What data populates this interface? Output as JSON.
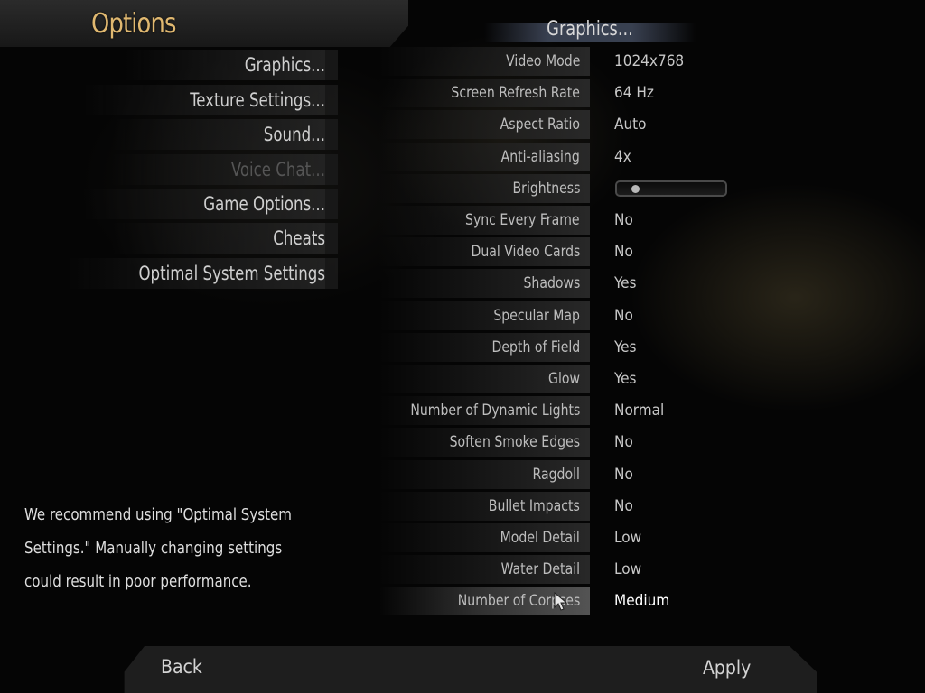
{
  "title": "Options",
  "menu": [
    {
      "label": "Graphics...",
      "disabled": false
    },
    {
      "label": "Texture Settings...",
      "disabled": false
    },
    {
      "label": "Sound...",
      "disabled": false
    },
    {
      "label": "Voice Chat...",
      "disabled": true
    },
    {
      "label": "Game Options...",
      "disabled": false
    },
    {
      "label": "Cheats",
      "disabled": false
    },
    {
      "label": "Optimal System Settings",
      "disabled": false
    }
  ],
  "section_title": "Graphics...",
  "settings": [
    {
      "label": "Video Mode",
      "value": "1024x768"
    },
    {
      "label": "Screen Refresh Rate",
      "value": "64 Hz"
    },
    {
      "label": "Aspect Ratio",
      "value": "Auto"
    },
    {
      "label": "Anti-aliasing",
      "value": "4x"
    },
    {
      "label": "Brightness",
      "value": ""
    },
    {
      "label": "Sync Every Frame",
      "value": "No"
    },
    {
      "label": "Dual Video Cards",
      "value": "No"
    },
    {
      "label": "Shadows",
      "value": "Yes"
    },
    {
      "label": "Specular Map",
      "value": "No"
    },
    {
      "label": "Depth of Field",
      "value": "Yes"
    },
    {
      "label": "Glow",
      "value": "Yes"
    },
    {
      "label": "Number of Dynamic Lights",
      "value": "Normal"
    },
    {
      "label": "Soften Smoke Edges",
      "value": "No"
    },
    {
      "label": "Ragdoll",
      "value": "No"
    },
    {
      "label": "Bullet Impacts",
      "value": "No"
    },
    {
      "label": "Model Detail",
      "value": "Low"
    },
    {
      "label": "Water Detail",
      "value": "Low"
    },
    {
      "label": "Number of Corpses",
      "value": "Medium"
    }
  ],
  "brightness_level": 0.12,
  "recommendation": "We recommend using \"Optimal System Settings.\" Manually changing settings could result in poor performance.",
  "buttons": {
    "back": "Back",
    "apply": "Apply"
  },
  "cursor_icon": "arrow-cursor-icon"
}
